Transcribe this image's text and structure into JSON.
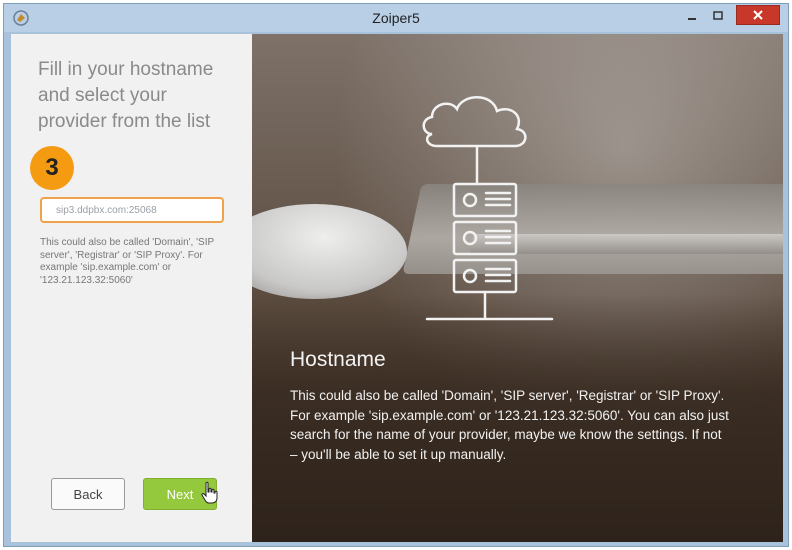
{
  "window": {
    "title": "Zoiper5",
    "icon": "zoiper-logo-icon",
    "controls": [
      "minimize-icon",
      "maximize-icon",
      "close-icon"
    ]
  },
  "wizard": {
    "heading": "Fill in your hostname and select your provider from the list",
    "step_number": "3",
    "hostname_input": {
      "value": "sip3.ddpbx.com:25068",
      "placeholder": ""
    },
    "helper_text": "This could also be called 'Domain', 'SIP server', 'Registrar' or 'SIP Proxy'. For example 'sip.example.com' or '123.21.123.32:5060'",
    "buttons": {
      "back": "Back",
      "next": "Next"
    }
  },
  "info_panel": {
    "title": "Hostname",
    "body": "This could also be called 'Domain', 'SIP server', 'Registrar' or 'SIP Proxy'. For example 'sip.example.com' or '123.21.123.32:5060'. You can also just search for the name of your provider, maybe we know the settings. If not – you'll be able to set it up manually.",
    "illustration": "cloud-server-sketch-icon"
  },
  "colors": {
    "accent_orange": "#f49b12",
    "next_green": "#94c83d",
    "close_red": "#c7372a"
  }
}
